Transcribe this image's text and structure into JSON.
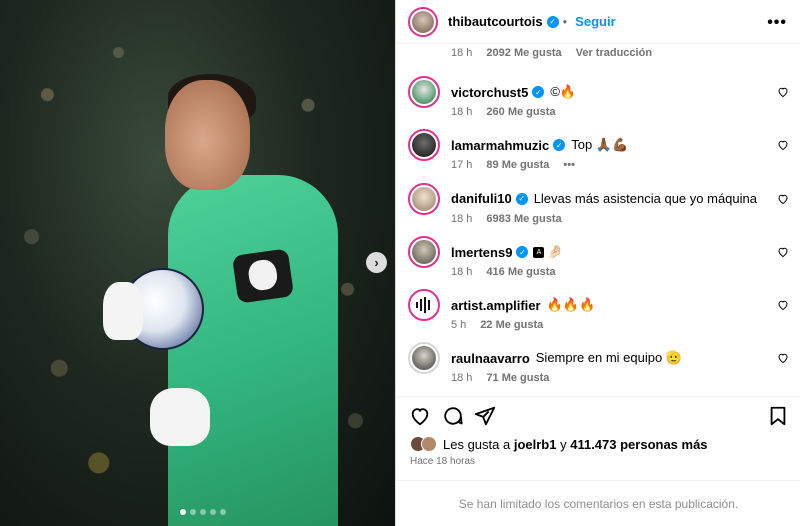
{
  "post": {
    "author": "thibautcourtois",
    "follow_label": "Seguir",
    "first_meta": {
      "time": "18 h",
      "likes": "2092 Me gusta",
      "translate": "Ver traducción"
    }
  },
  "comments": [
    {
      "user": "victorchust5",
      "text": "©🔥",
      "time": "18 h",
      "likes": "260 Me gusta",
      "verified": true
    },
    {
      "user": "lamarmahmuzic",
      "text": "Top 🙏🏾💪🏾",
      "time": "17 h",
      "likes": "89 Me gusta",
      "verified": true,
      "more": "•••"
    },
    {
      "user": "danifuli10",
      "text": "Llevas más asistencia que yo máquina",
      "time": "18 h",
      "likes": "6983 Me gusta",
      "verified": true
    },
    {
      "user": "lmertens9",
      "text": "🤌🏻",
      "badge": "A",
      "time": "18 h",
      "likes": "416 Me gusta",
      "verified": true
    },
    {
      "user": "artist.amplifier",
      "text": "🔥🔥🔥",
      "time": "5 h",
      "likes": "22 Me gusta",
      "verified": false
    },
    {
      "user": "raulnaavarro",
      "text": "Siempre en mi equipo 🫡",
      "time": "18 h",
      "likes": "71 Me gusta",
      "verified": false
    }
  ],
  "likes_summary": {
    "prefix": "Les gusta a",
    "first_user": "joelrb1",
    "connector": "y",
    "others": "411.473 personas más"
  },
  "timestamp": "Hace 18 horas",
  "comments_limited": "Se han limitado los comentarios en esta publicación.",
  "colors": {
    "accent": "#0095f6",
    "story_ring": "#e0318e",
    "muted": "#737373"
  },
  "icons": [
    "more-options-icon",
    "verified-icon",
    "heart-icon",
    "comment-icon",
    "share-icon",
    "bookmark-icon",
    "chevron-right-icon"
  ]
}
